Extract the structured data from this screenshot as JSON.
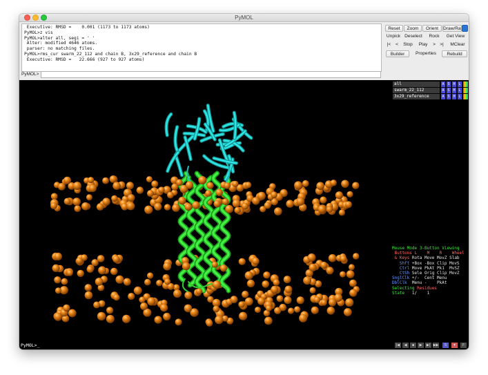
{
  "window": {
    "title": "PyMOL"
  },
  "console": {
    "lines": [
      " Executive: RMSD =    0.001 (1173 to 1173 atoms)",
      "PyMOL>z vis",
      "PyMOL>alter all, segi = ' '",
      " Alter: modified 4646 atoms.",
      " parser: no matching files.",
      "PyMOL>rms_cur swarm_22_112 and chain B, 3x29_reference and chain B",
      " Executive: RMSD =   22.666 (927 to 927 atoms)"
    ]
  },
  "command": {
    "label": "PyMOL>",
    "value": ""
  },
  "buttons": {
    "row1": [
      "Reset",
      "Zoom",
      "Orient",
      "Draw/Ray"
    ],
    "row2": [
      "Unpick",
      "Deselect",
      "Rock",
      "Get View"
    ],
    "row3": [
      "|<",
      "<",
      "Stop",
      "Play",
      ">",
      ">|",
      "MClear"
    ],
    "row4": [
      "Builder",
      "Properties",
      "Rebuild"
    ]
  },
  "objects": [
    {
      "name": "all",
      "buttons": [
        "A",
        "S",
        "H",
        "L"
      ]
    },
    {
      "name": "swarm_22_112",
      "buttons": [
        "A",
        "S",
        "H",
        "L"
      ]
    },
    {
      "name": "3x29_reference",
      "buttons": [
        "A",
        "S",
        "H",
        "L"
      ]
    }
  ],
  "mouse_mode": {
    "header": "Mouse Mode 3-Button Viewing",
    "rows": [
      {
        "label": " Buttons",
        "cols": [
          "L",
          "M",
          "R",
          "Wheel"
        ]
      },
      {
        "label": " & Keys",
        "cols": [
          "Rota",
          "Move",
          "MovZ",
          "Slab"
        ]
      },
      {
        "label": "   Shft",
        "cols": [
          "+Box",
          "-Box",
          "Clip",
          "MovS"
        ]
      },
      {
        "label": "   Ctrl",
        "cols": [
          "Move",
          "PkAt",
          "Pk1",
          "MvSZ"
        ]
      },
      {
        "label": "   CtSh",
        "cols": [
          "Sele",
          "Orig",
          "Clip",
          "MovZ"
        ]
      },
      {
        "label": "SnglClk",
        "cols": [
          "+/-",
          "Cent",
          "Menu",
          ""
        ]
      },
      {
        "label": "DblClk",
        "cols": [
          "Menu",
          "-",
          "PkAt",
          ""
        ]
      }
    ],
    "selecting": "Selecting",
    "selecting_value": "Residues",
    "state_label": "State",
    "state_value": "1/    1"
  },
  "bottom_prompt": "PyMOL>_",
  "colors": {
    "membrane": "#e07a10",
    "helix": "#33dd33",
    "sheet": "#22cccc",
    "accent_blue": "#2a74d6"
  }
}
